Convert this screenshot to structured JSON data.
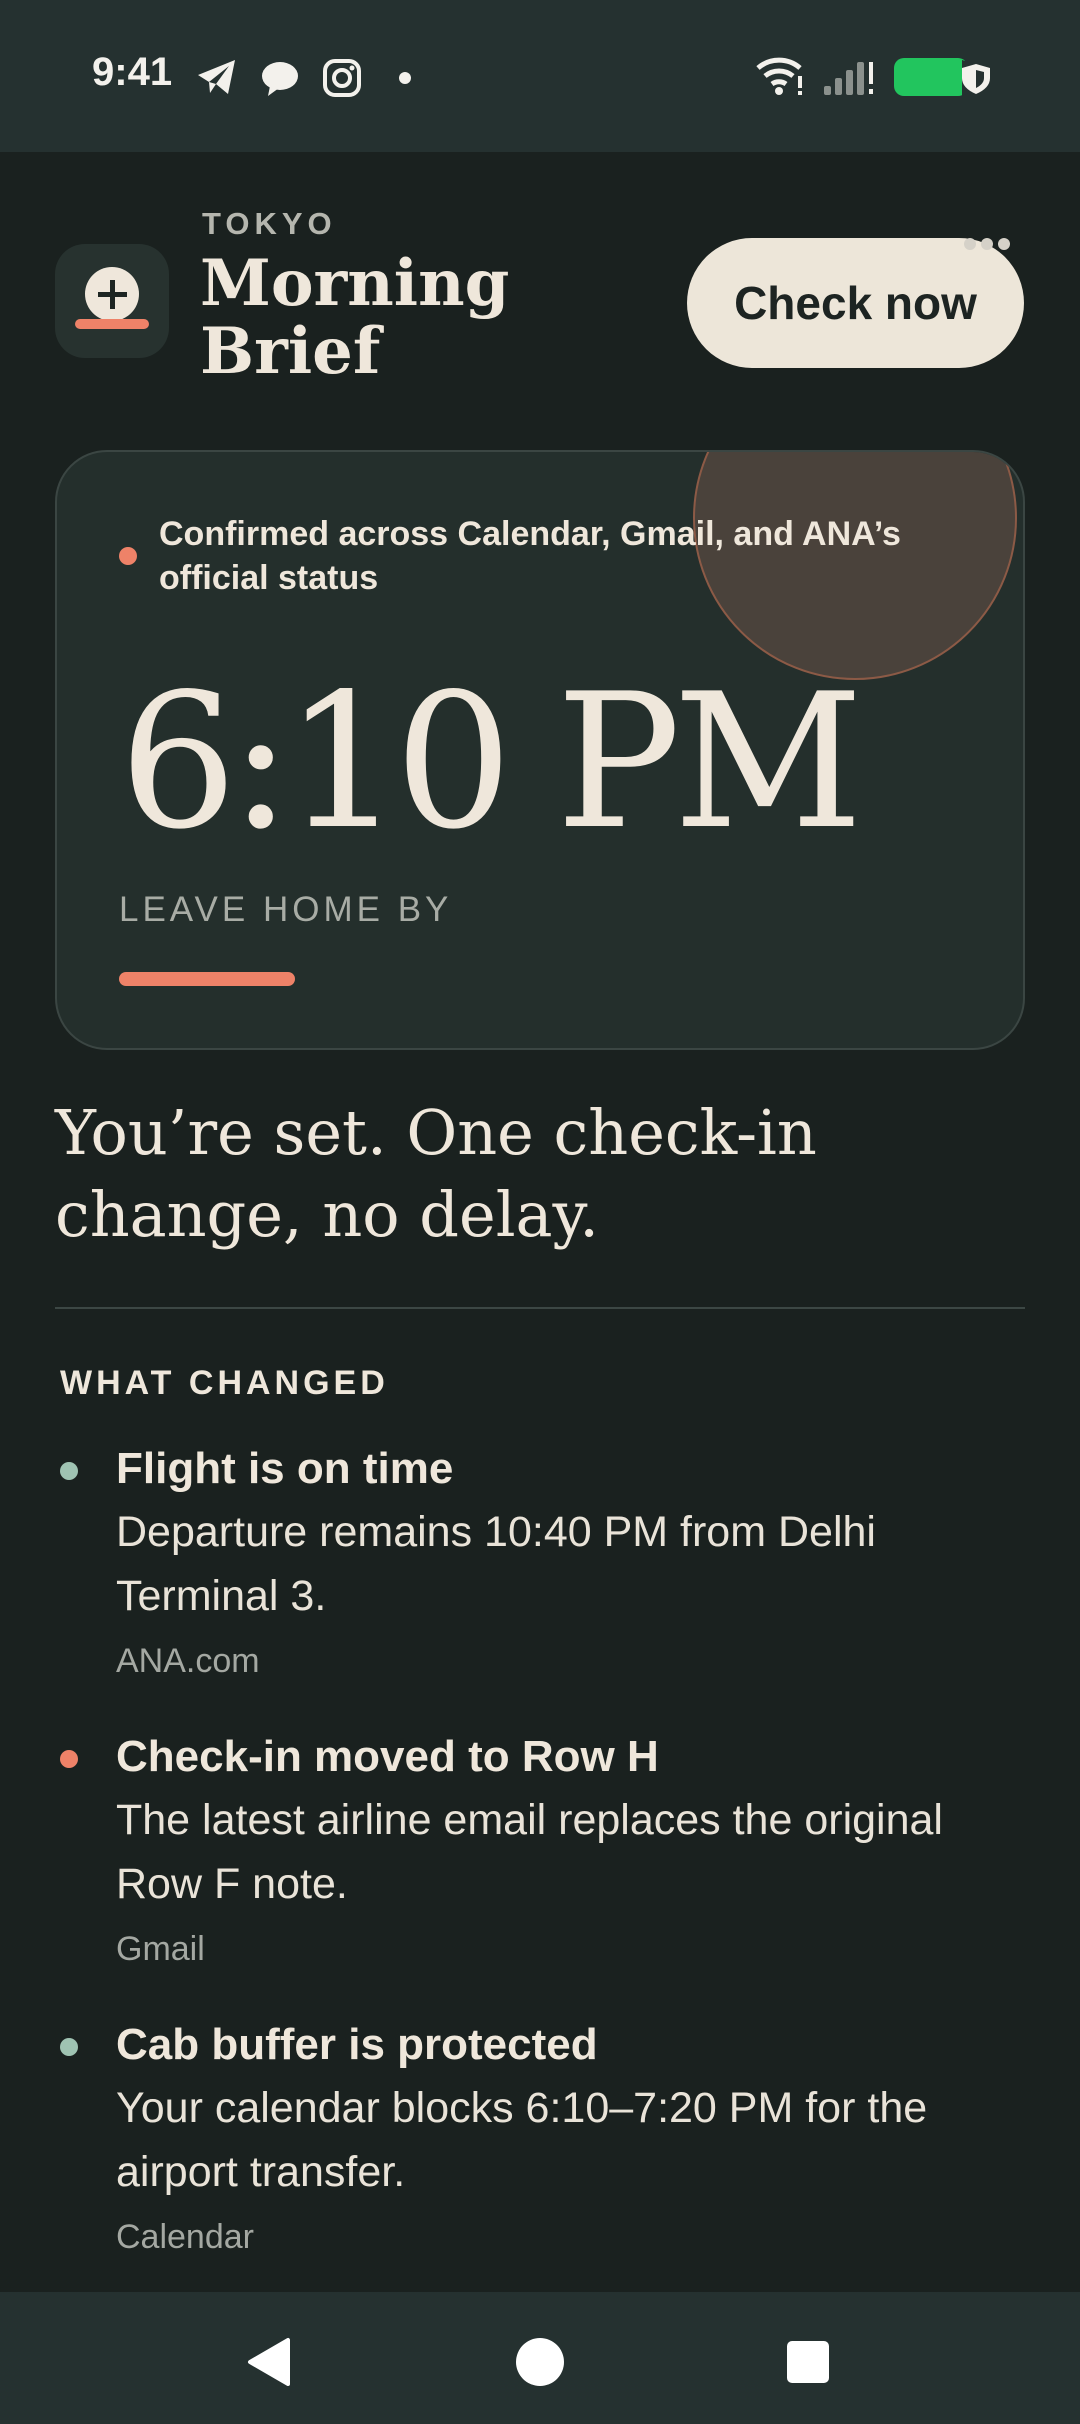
{
  "status_bar": {
    "time": "9:41",
    "left_icons": [
      "telegram-icon",
      "chat-bubble-icon",
      "instagram-icon",
      "dot-icon"
    ],
    "right_icons": [
      "wifi-icon",
      "signal-icon",
      "battery-icon"
    ],
    "battery_color": "#22c55e"
  },
  "header": {
    "city": "TOKYO",
    "title": "Morning Brief",
    "check_button": "Check now"
  },
  "hero": {
    "confirmation": "Confirmed across Calendar, Gmail, and ANA’s official status",
    "time": "6:10 PM",
    "label": "LEAVE HOME BY"
  },
  "summary": "You’re set. One check-in change, no delay.",
  "changes": {
    "heading": "WHAT CHANGED",
    "items": [
      {
        "title": "Flight is on time",
        "body": "Departure remains 10:40 PM from Delhi Terminal 3.",
        "source": "ANA.com",
        "dot_color": "#9fc3b2"
      },
      {
        "title": "Check-in moved to Row H",
        "body": "The latest airline email replaces the original Row F note.",
        "source": "Gmail",
        "dot_color": "#ee8268"
      },
      {
        "title": "Cab buffer is protected",
        "body": "Your calendar blocks 6:10–7:20 PM for the airport transfer.",
        "source": "Calendar",
        "dot_color": "#9fc3b2"
      }
    ]
  },
  "colors": {
    "background": "#1a211f",
    "accent": "#ee8268",
    "cream": "#efe7db"
  },
  "nav": [
    "back-icon",
    "home-icon",
    "recents-icon"
  ]
}
